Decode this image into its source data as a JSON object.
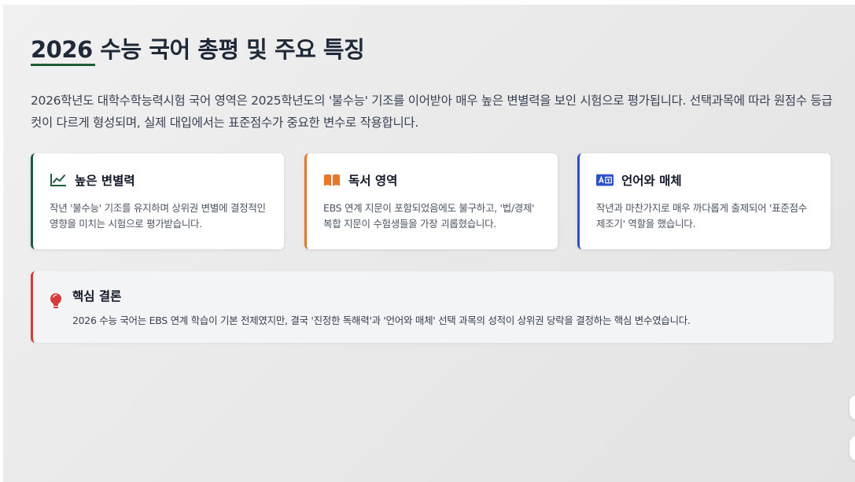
{
  "page": {
    "title": "2026 수능 국어 총평 및 주요 특징",
    "intro": "2026학년도 대학수학능력시험 국어 영역은 2025학년도의 '불수능' 기조를 이어받아 매우 높은 변별력을 보인 시험으로 평가됩니다. 선택과목에 따라 원점수 등급컷이 다르게 형성되며, 실제 대입에서는 표준점수가 중요한 변수로 작용합니다."
  },
  "cards": [
    {
      "icon": "chart-line-icon",
      "title": "높은 변별력",
      "body": "작년 '불수능' 기조를 유지하며 상위권 변별에 결정적인 영향을 미치는 시험으로 평가받습니다.",
      "accent": "#1e5d3a"
    },
    {
      "icon": "book-open-icon",
      "title": "독서 영역",
      "body": "EBS 연계 지문이 포함되었음에도 불구하고, '법/경제' 복합 지문이 수험생들을 가장 괴롭혔습니다.",
      "accent": "#e8772e"
    },
    {
      "icon": "language-icon",
      "title": "언어와 매체",
      "body": "작년과 마찬가지로 매우 까다롭게 출제되어 '표준점수 제조기' 역할을 했습니다.",
      "accent": "#2f4fc7"
    }
  ],
  "conclusion": {
    "icon": "lightbulb-icon",
    "title": "핵심 결론",
    "text": "2026 수능 국어는 EBS 연계 학습이 기본 전제였지만, 결국 '진정한 독해력'과 '언어와 매체' 선택 과목의 성적이 상위권 당락을 결정하는 핵심 변수였습니다.",
    "accent": "#d63a3a"
  }
}
